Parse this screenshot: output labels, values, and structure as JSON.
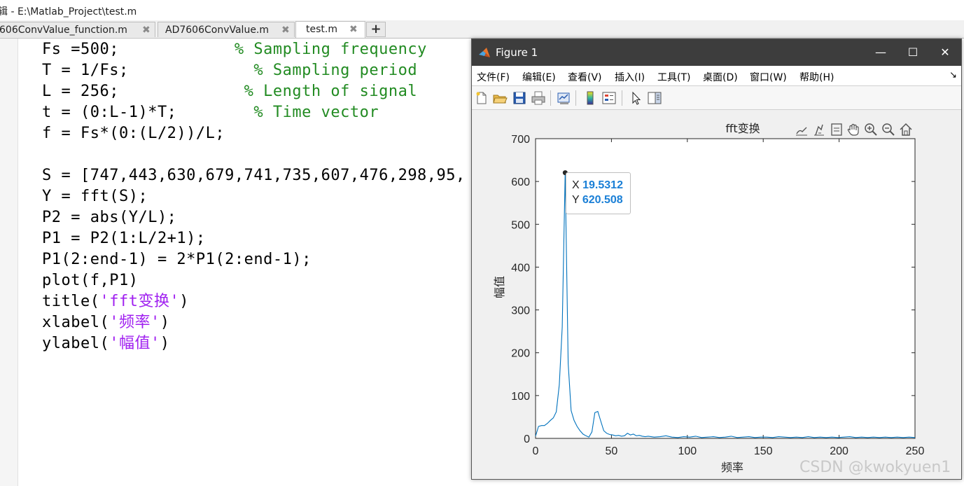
{
  "window": {
    "title": "辑 - E:\\Matlab_Project\\test.m"
  },
  "tabs": [
    {
      "label": "606ConvValue_function.m",
      "close": "✖"
    },
    {
      "label": "AD7606ConvValue.m",
      "close": "✖"
    },
    {
      "label": "test.m",
      "close": "✖"
    }
  ],
  "add_tab": "+",
  "code": {
    "lines": [
      {
        "code": "Fs =500;",
        "pad": "            ",
        "comment": "% Sampling frequency"
      },
      {
        "code": "T = 1/Fs;",
        "pad": "             ",
        "comment": "% Sampling period"
      },
      {
        "code": "L = 256;",
        "pad": "             ",
        "comment": "% Length of signal"
      },
      {
        "code": "t = (0:L-1)*T;",
        "pad": "        ",
        "comment": "% Time vector"
      },
      {
        "code": "f = Fs*(0:(L/2))/L;"
      },
      {
        "code": ""
      },
      {
        "code": "S = [747,443,630,679,741,735,607,476,298,95,"
      },
      {
        "code": "Y = fft(S);"
      },
      {
        "code": "P2 = abs(Y/L);"
      },
      {
        "code": "P1 = P2(1:L/2+1);"
      },
      {
        "code": "P1(2:end-1) = 2*P1(2:end-1);"
      },
      {
        "code": "plot(f,P1)"
      },
      {
        "pre": "title(",
        "str": "'fft变换'",
        "post": ")"
      },
      {
        "pre": "xlabel(",
        "str": "'频率'",
        "post": ")"
      },
      {
        "pre": "ylabel(",
        "str": "'幅值'",
        "post": ")"
      }
    ]
  },
  "figure": {
    "title": "Figure 1",
    "window_buttons": {
      "minimize": "—",
      "maximize": "☐",
      "close": "✕"
    },
    "menu": [
      "文件(F)",
      "编辑(E)",
      "查看(V)",
      "插入(I)",
      "工具(T)",
      "桌面(D)",
      "窗口(W)",
      "帮助(H)"
    ],
    "menu_corner": "↘",
    "toolbar": [
      "new-figure-icon",
      "open-folder-icon",
      "save-icon",
      "print-icon",
      "link-plot-icon",
      "colorbar-icon",
      "legend-icon",
      "pointer-icon",
      "property-editor-icon"
    ],
    "axes_toolbar": [
      "brush-icon",
      "data-tips-icon",
      "export-icon",
      "pan-icon",
      "zoom-in-icon",
      "zoom-out-icon",
      "home-icon"
    ],
    "datatip": {
      "x_label": "X",
      "x_value": "19.5312",
      "y_label": "Y",
      "y_value": "620.508"
    }
  },
  "watermark": "CSDN @kwokyuen1",
  "colors": {
    "line": "#0072bd",
    "comment": "#228b22",
    "string": "#a020f0",
    "datatip_value": "#1a7fd6",
    "fig_titlebar": "#3d3d3d"
  },
  "chart_data": {
    "type": "line",
    "title": "fft变换",
    "xlabel": "频率",
    "ylabel": "幅值",
    "xlim": [
      0,
      250
    ],
    "ylim": [
      0,
      700
    ],
    "xticks": [
      0,
      50,
      100,
      150,
      200,
      250
    ],
    "yticks": [
      0,
      100,
      200,
      300,
      400,
      500,
      600,
      700
    ],
    "grid": false,
    "series": [
      {
        "x": [
          0,
          1.95,
          3.91,
          5.86,
          7.81,
          9.77,
          11.72,
          13.67,
          15.63,
          17.58,
          19.53,
          21.48,
          23.44,
          25.39,
          27.34,
          29.3,
          31.25,
          33.2,
          35.16,
          37.11,
          39.06,
          41.02,
          42.97,
          44.92,
          46.88,
          48.83,
          50.78,
          52.73,
          54.69,
          56.64,
          58.59,
          60.55,
          62.5,
          64.45,
          66.41,
          68.36,
          70.31,
          72.27,
          74.22,
          78.13,
          82.03,
          85.94,
          89.84,
          93.75,
          97.66,
          101.56,
          105.47,
          109.38,
          113.28,
          117.19,
          121.09,
          125.0,
          128.91,
          132.81,
          136.72,
          140.63,
          144.53,
          148.44,
          152.34,
          156.25,
          160.16,
          164.06,
          167.97,
          171.88,
          175.78,
          179.69,
          183.59,
          187.5,
          191.41,
          195.31,
          199.22,
          203.13,
          207.03,
          210.94,
          214.84,
          218.75,
          222.66,
          226.56,
          230.47,
          234.38,
          238.28,
          242.19,
          246.09,
          250.0
        ],
        "values": [
          5,
          28,
          30,
          30,
          35,
          42,
          48,
          62,
          125,
          260,
          620.5,
          175,
          65,
          42,
          28,
          18,
          10,
          6,
          3,
          15,
          60,
          63,
          40,
          18,
          12,
          9,
          8,
          6,
          7,
          5,
          6,
          12,
          8,
          10,
          6,
          7,
          5,
          4,
          5,
          3,
          4,
          6,
          3,
          2,
          4,
          3,
          5,
          2,
          3,
          4,
          2,
          3,
          5,
          2,
          3,
          4,
          2,
          3,
          3,
          2,
          4,
          3,
          2,
          3,
          2,
          4,
          2,
          3,
          2,
          3,
          2,
          3,
          4,
          2,
          3,
          2,
          3,
          2,
          3,
          2,
          3,
          2,
          3,
          2
        ]
      }
    ]
  }
}
